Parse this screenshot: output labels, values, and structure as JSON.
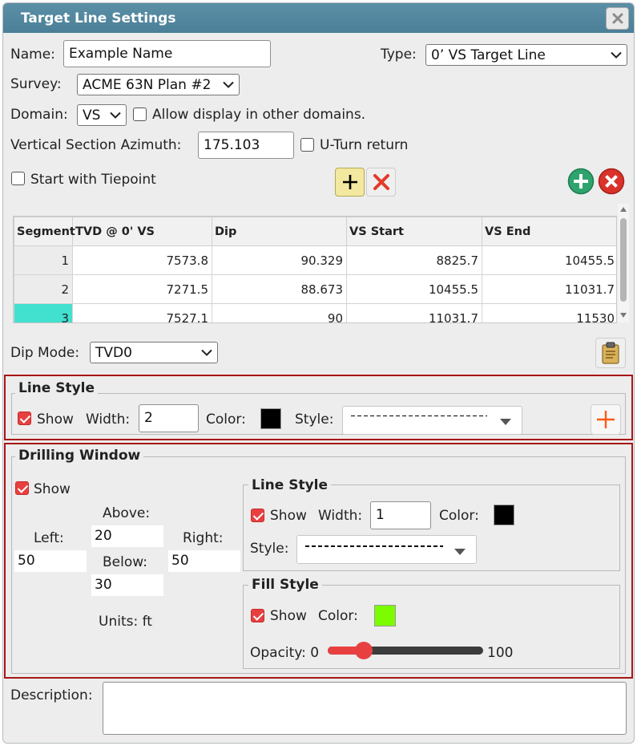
{
  "window": {
    "title": "Target Line Settings"
  },
  "form": {
    "name_label": "Name:",
    "name_value": "Example Name",
    "type_label": "Type:",
    "type_value": "0’ VS Target Line",
    "survey_label": "Survey:",
    "survey_value": "ACME 63N Plan #2",
    "domain_label": "Domain:",
    "domain_value": "VS",
    "allow_display_label": "Allow display in other domains.",
    "allow_display_checked": false,
    "vsa_label": "Vertical Section Azimuth:",
    "vsa_value": "175.103",
    "uturn_label": "U-Turn return",
    "uturn_checked": false,
    "tiepoint_label": "Start with Tiepoint",
    "tiepoint_checked": false,
    "dip_mode_label": "Dip Mode:",
    "dip_mode_value": "TVD0",
    "description_label": "Description:",
    "description_value": ""
  },
  "table": {
    "headers": [
      "Segment",
      "TVD @ 0' VS",
      "Dip",
      "VS Start",
      "VS End"
    ],
    "rows": [
      [
        "1",
        "7573.8",
        "90.329",
        "8825.7",
        "10455.5"
      ],
      [
        "2",
        "7271.5",
        "88.673",
        "10455.5",
        "11031.7"
      ],
      [
        "3",
        "7527.1",
        "90",
        "11031.7",
        "11530"
      ]
    ],
    "selected_row": 3
  },
  "line_style": {
    "legend": "Line Style",
    "show_label": "Show",
    "show_checked": true,
    "width_label": "Width:",
    "width_value": "2",
    "color_label": "Color:",
    "color": "#000000",
    "style_label": "Style:"
  },
  "drilling_window": {
    "legend": "Drilling Window",
    "show_label": "Show",
    "show_checked": true,
    "above_label": "Above:",
    "above_value": "20",
    "left_label": "Left:",
    "left_value": "50",
    "right_label": "Right:",
    "right_value": "50",
    "below_label": "Below:",
    "below_value": "30",
    "units_label": "Units: ft",
    "line_style": {
      "legend": "Line Style",
      "show_label": "Show",
      "show_checked": true,
      "width_label": "Width:",
      "width_value": "1",
      "color_label": "Color:",
      "color": "#000000",
      "style_label": "Style:"
    },
    "fill_style": {
      "legend": "Fill Style",
      "show_label": "Show",
      "show_checked": true,
      "color_label": "Color:",
      "color": "#7cfc00",
      "opacity_label": "Opacity: 0",
      "opacity_max_label": "100",
      "opacity_value": 20
    }
  },
  "colors": {
    "accent_red": "#e84040",
    "title_bar": "#4a7f97",
    "selection": "#42e0cf",
    "border_red": "#a81616"
  }
}
